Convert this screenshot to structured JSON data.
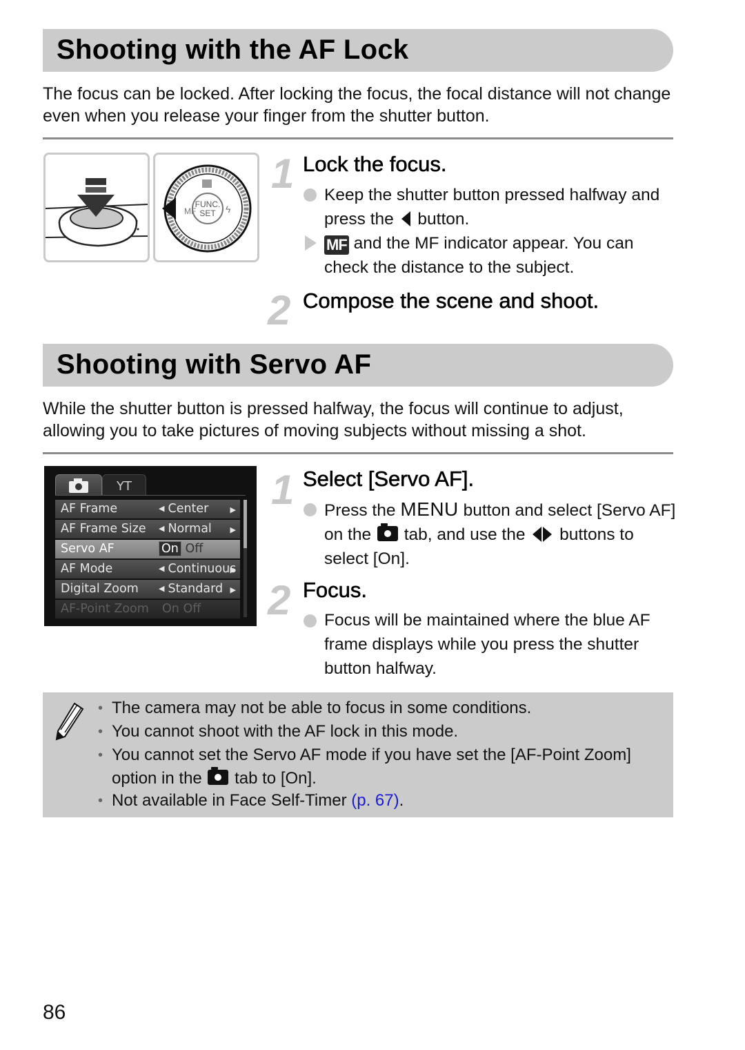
{
  "section1": {
    "title": "Shooting with the AF Lock",
    "intro": "The focus can be locked. After locking the focus, the focal distance will not change even when you release your finger from the shutter button.",
    "steps": [
      {
        "number": "1",
        "title": "Lock the focus.",
        "bullets": [
          {
            "type": "circle",
            "parts": [
              "Keep the shutter button pressed halfway and press the ",
              " button."
            ],
            "icon": "left-arrow"
          },
          {
            "type": "triangle",
            "icon": "mf-icon",
            "icon_text": "MF",
            "text": " and the MF indicator appear. You can check the distance to the subject."
          }
        ]
      },
      {
        "number": "2",
        "title": "Compose the scene and shoot."
      }
    ],
    "illustration": {
      "dial_labels": {
        "center_top": "FUNC.",
        "center_bottom": "SET",
        "left": "MF"
      }
    }
  },
  "section2": {
    "title": "Shooting with Servo AF",
    "intro": "While the shutter button is pressed halfway, the focus will continue to adjust, allowing you to take pictures of moving subjects without missing a shot.",
    "steps": [
      {
        "number": "1",
        "title": "Select [Servo AF].",
        "bullet": {
          "p1": "Press the ",
          "menu_word": "MENU",
          "p2": " button and select [Servo AF] on the ",
          "p3": " tab, and use the ",
          "p4": " buttons to select [On]."
        }
      },
      {
        "number": "2",
        "title": "Focus.",
        "bullet": "Focus will be maintained where the blue AF frame displays while you press the shutter button halfway."
      }
    ],
    "camera_menu": {
      "tabs": [
        "camera-tab",
        "settings-tab"
      ],
      "rows": [
        {
          "label": "AF Frame",
          "value": "Center",
          "state": "normal"
        },
        {
          "label": "AF Frame Size",
          "value": "Normal",
          "state": "normal"
        },
        {
          "label": "Servo AF",
          "on": "On",
          "off": "Off",
          "state": "selected"
        },
        {
          "label": "AF Mode",
          "value": "Continuous",
          "state": "normal"
        },
        {
          "label": "Digital Zoom",
          "value": "Standard",
          "state": "normal"
        },
        {
          "label": "AF-Point Zoom",
          "on": "On",
          "off": "Off",
          "state": "disabled"
        }
      ]
    }
  },
  "notes": {
    "items": [
      "The camera may not be able to focus in some conditions.",
      "You cannot shoot with the AF lock in this mode.",
      {
        "p1": "You cannot set the Servo AF mode if you have set the [AF-Point Zoom] option in the ",
        "p2": " tab to [On]."
      },
      {
        "p1": "Not available in Face Self-Timer ",
        "link": "(p. 67)",
        "p2": "."
      }
    ],
    "link_color": "#1a1ad6"
  },
  "page_number": "86",
  "colors": {
    "banner": "#cbcbcb",
    "step_number": "#c8c8c8",
    "rule": "#8a8a8a",
    "note_bg": "#cbcbcb"
  }
}
